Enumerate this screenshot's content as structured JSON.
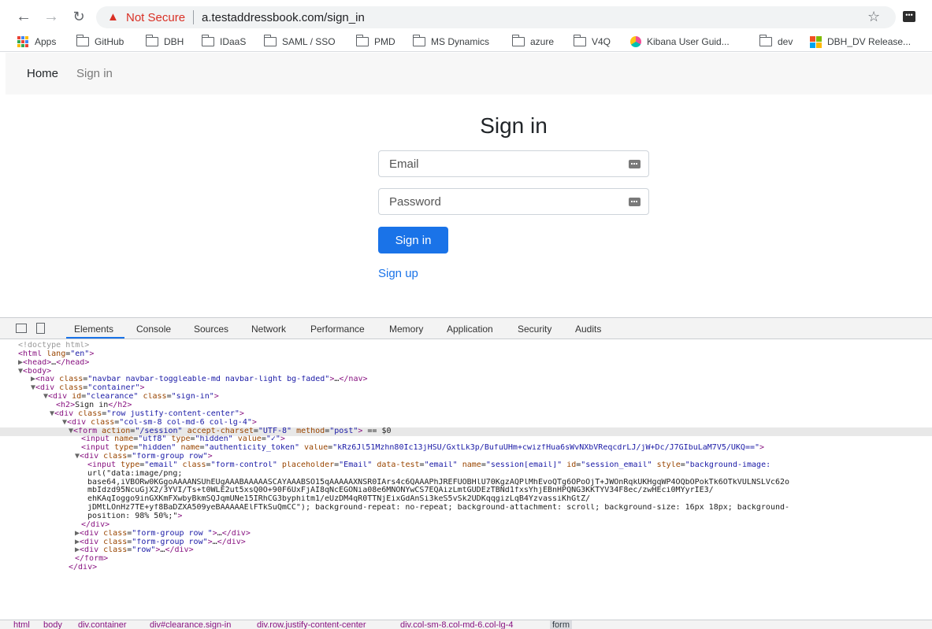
{
  "browser": {
    "not_secure_label": "Not Secure",
    "url": "a.testaddressbook.com/sign_in",
    "bookmarks": [
      {
        "label": "Apps",
        "icon": "apps-grid-icon"
      },
      {
        "label": "GitHub",
        "icon": "folder-icon"
      },
      {
        "label": "DBH",
        "icon": "folder-icon"
      },
      {
        "label": "IDaaS",
        "icon": "folder-icon"
      },
      {
        "label": "SAML / SSO",
        "icon": "folder-icon"
      },
      {
        "label": "PMD",
        "icon": "folder-icon"
      },
      {
        "label": "MS Dynamics",
        "icon": "folder-icon"
      },
      {
        "label": "azure",
        "icon": "folder-icon"
      },
      {
        "label": "V4Q",
        "icon": "folder-icon"
      },
      {
        "label": "Kibana User Guid...",
        "icon": "kibana-icon"
      },
      {
        "label": "dev",
        "icon": "folder-icon"
      },
      {
        "label": "DBH_DV Release...",
        "icon": "microsoft-icon"
      }
    ]
  },
  "site": {
    "nav": {
      "brand": "Home",
      "link": "Sign in"
    },
    "title": "Sign in",
    "email_placeholder": "Email",
    "password_placeholder": "Password",
    "submit_label": "Sign in",
    "signup_label": "Sign up"
  },
  "devtools": {
    "tabs": [
      "Elements",
      "Console",
      "Sources",
      "Network",
      "Performance",
      "Memory",
      "Application",
      "Security",
      "Audits"
    ],
    "active_tab": "Elements",
    "dom_lines": [
      "<!doctype html>",
      "<html lang=\"en\">",
      "▶<head>…</head>",
      "▼<body>",
      "▶<nav class=\"navbar navbar-toggleable-md navbar-light bg-faded\">…</nav>",
      "▼<div class=\"container\">",
      "▼<div id=\"clearance\" class=\"sign-in\">",
      "<h2>Sign in</h2>",
      "▼<div class=\"row justify-content-center\">",
      "▼<div class=\"col-sm-8 col-md-6 col-lg-4\">",
      "▼<form action=\"/session\" accept-charset=\"UTF-8\" method=\"post\"> == $0",
      "<input name=\"utf8\" type=\"hidden\" value=\"✓\">",
      "<input type=\"hidden\" name=\"authenticity_token\" value=\"kRz6Jl51Mzhn80Ic13jHSU/GxtLk3p/BufuUHm+cwizfHua6sWvNXbVReqcdrLJ/jW+Dc/J7GIbuLaM7V5/UKQ==\">",
      "▼<div class=\"form-group row\">",
      "<input type=\"email\" class=\"form-control\" placeholder=\"Email\" data-test=\"email\" name=\"session[email]\" id=\"session_email\" style=\"background-image:",
      "url(\"data:image/png;",
      "base64,iVBORw0KGgoAAAANSUhEUgAAABAAAAASCAYAAABSO15qAAAAAXNSR0IArs4c6QAAAPhJREFUOBHlU70KgzAQPlMhEvoQTg6OPoOjT+JWOnRqkUKHgqWP4OQbOPokTk6OTkVULNSLVc62o",
      "mbIdzd95NcuGjX2/3YVI/Ts+t0WLE2ut5xsQ0O+90F6UxFjAI8qNcEGONia08e6MNONYwCS7EQAizLmtGUDEzTBNd1fxsYhjEBnHPQNG3KKTYV34F8ec/zwHEci0MYyrIE3/",
      "ehKAqIoggo9inGXKmFXwbyBkmSQJqmUNe15IRhCG3byphitm1/eUzDM4qR0TTNjEixGdAnSi3keS5vSk2UDKqqgizLqB4YzvassiKhGtZ/",
      "jDMtLOnHz7TE+yf8BaDZXA509yeBAAAAAElFTkSuQmCC\"); background-repeat: no-repeat; background-attachment: scroll; background-size: 16px 18px; background-",
      "position: 98% 50%;\">",
      "</div>",
      "▶<div class=\"form-group row \">…</div>",
      "▶<div class=\"form-group row\">…</div>",
      "▶<div class=\"row\">…</div>",
      "</form>",
      "</div>"
    ],
    "breadcrumbs": [
      "html",
      "body",
      "div.container",
      "div#clearance.sign-in",
      "div.row.justify-content-center",
      "div.col-sm-8.col-md-6.col-lg-4",
      "form"
    ]
  }
}
